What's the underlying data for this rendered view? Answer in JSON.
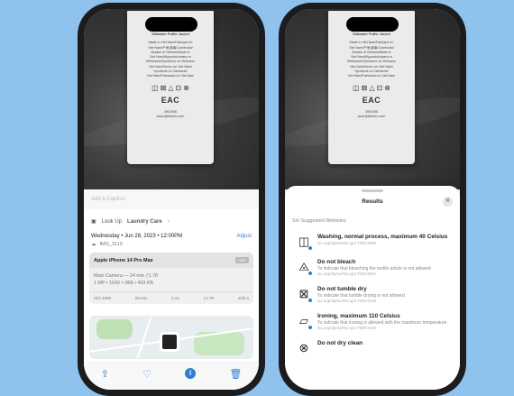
{
  "left_phone": {
    "caption_placeholder": "Add a Caption",
    "lookup": {
      "prefix": "Look Up",
      "subject": "Laundry Care",
      "chevron": "›"
    },
    "date": "Wednesday • Jun 28, 2023 • 12:00PM",
    "adjust": "Adjust",
    "filename": "IMG_3110",
    "camera": {
      "model": "Apple iPhone 14 Pro Max",
      "badge": "HEIF",
      "lens": "Main Camera — 24 mm ƒ1.78",
      "resolution": "1 MP • 1543 × 868 • 493 KB",
      "specs": [
        "ISO 1000",
        "26 mm",
        "0 ev",
        "ƒ1.78",
        "1/40 s"
      ]
    },
    "toolbar": [
      "share-icon",
      "heart-icon",
      "info-icon",
      "trash-icon"
    ]
  },
  "tag_text": {
    "brand": "Stillwater Puffer Jacket",
    "lines": [
      "Made in Viet Nam/Fabriqué en",
      "Viet Nam/产地:越南/Cambodia/",
      "Buatan di Vietnam/Made in",
      "Viet Nam/Wyprodukowano w",
      "Wietnamie/Vyrobeno ve Vietnamu",
      "Viet Nam/Hecho en Viet Nam/",
      "Vyrobené vo Vietname/",
      "Viet Nam/Fabricado en Viet Nam"
    ],
    "care_symbols": [
      "◫",
      "⊠",
      "△",
      "⊡",
      "⊗"
    ],
    "mark": "EAC",
    "footer": [
      "3901946",
      "www.fjallraven.com"
    ]
  },
  "right_phone": {
    "sheet_title": "Results",
    "section": "Siri Suggested Websites",
    "results": [
      {
        "icon": "washing-icon",
        "glyph": "◫",
        "title": "Washing, normal process, maximum 40 Celsius",
        "desc": "",
        "url": "iso.org/obp/ui/#iso:grs:7000:3089"
      },
      {
        "icon": "no-bleach-icon",
        "glyph": "⨻",
        "title": "Do not bleach",
        "desc": "To indicate that bleaching the textile article is not allowed",
        "url": "iso.org/obp/ui/#iso:grs:7000:3094"
      },
      {
        "icon": "no-tumble-dry-icon",
        "glyph": "⊠",
        "title": "Do not tumble dry",
        "desc": "To indicate that tumble drying is not allowed",
        "url": "iso.org/obp/ui/#iso:grs:7000:3109"
      },
      {
        "icon": "ironing-icon",
        "glyph": "⏥",
        "title": "Ironing, maximum 110 Celsius",
        "desc": "To indicate that ironing is allowed with the maximum temperature",
        "url": "iso.org/obp/ui/#iso:grs:7000:3102"
      },
      {
        "icon": "no-dry-clean-icon",
        "glyph": "⊗",
        "title": "Do not dry clean",
        "desc": "",
        "url": ""
      }
    ]
  }
}
